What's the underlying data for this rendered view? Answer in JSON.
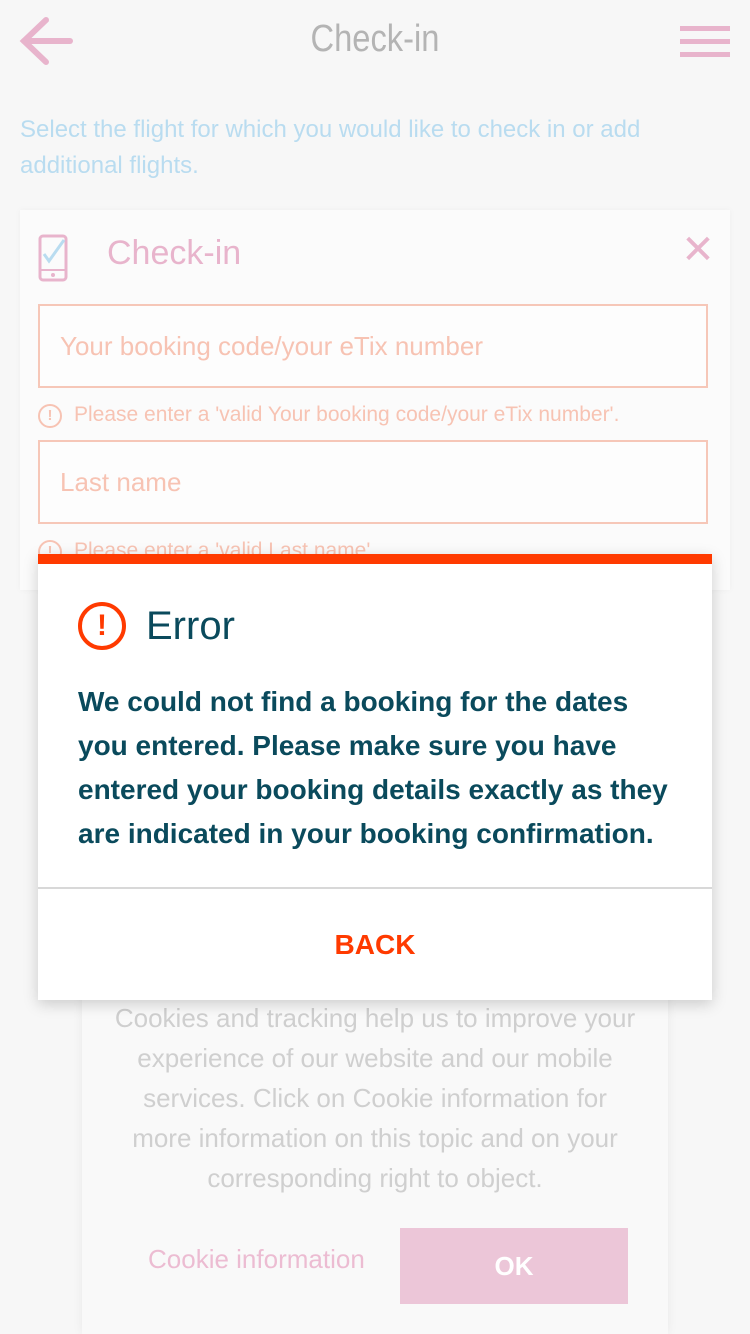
{
  "header": {
    "title": "Check-in"
  },
  "intro": {
    "text": "Select the flight for which you would like to check in or add additional flights."
  },
  "card": {
    "title": "Check-in",
    "booking_field": {
      "placeholder": "Your booking code/your eTix number",
      "error": "Please enter a 'valid Your booking code/your eTix number'."
    },
    "lastname_field": {
      "placeholder": "Last name",
      "error": "Please enter a 'valid Last name'."
    }
  },
  "modal": {
    "title": "Error",
    "body": "We could not find a booking for the dates you entered. Please make sure you have entered your booking details exactly as they are indicated in your booking confirmation.",
    "back_label": "BACK"
  },
  "cookie": {
    "text": "Cookies and tracking help us to improve your experience of our website and our mobile services. Click on Cookie information for more information on this topic and on your corresponding right to object.",
    "info_link": "Cookie information",
    "ok_label": "OK"
  },
  "colors": {
    "accent_error": "#ff3a00",
    "primary_text": "#0a4a5c",
    "brand_pink": "#e8b4cc"
  }
}
